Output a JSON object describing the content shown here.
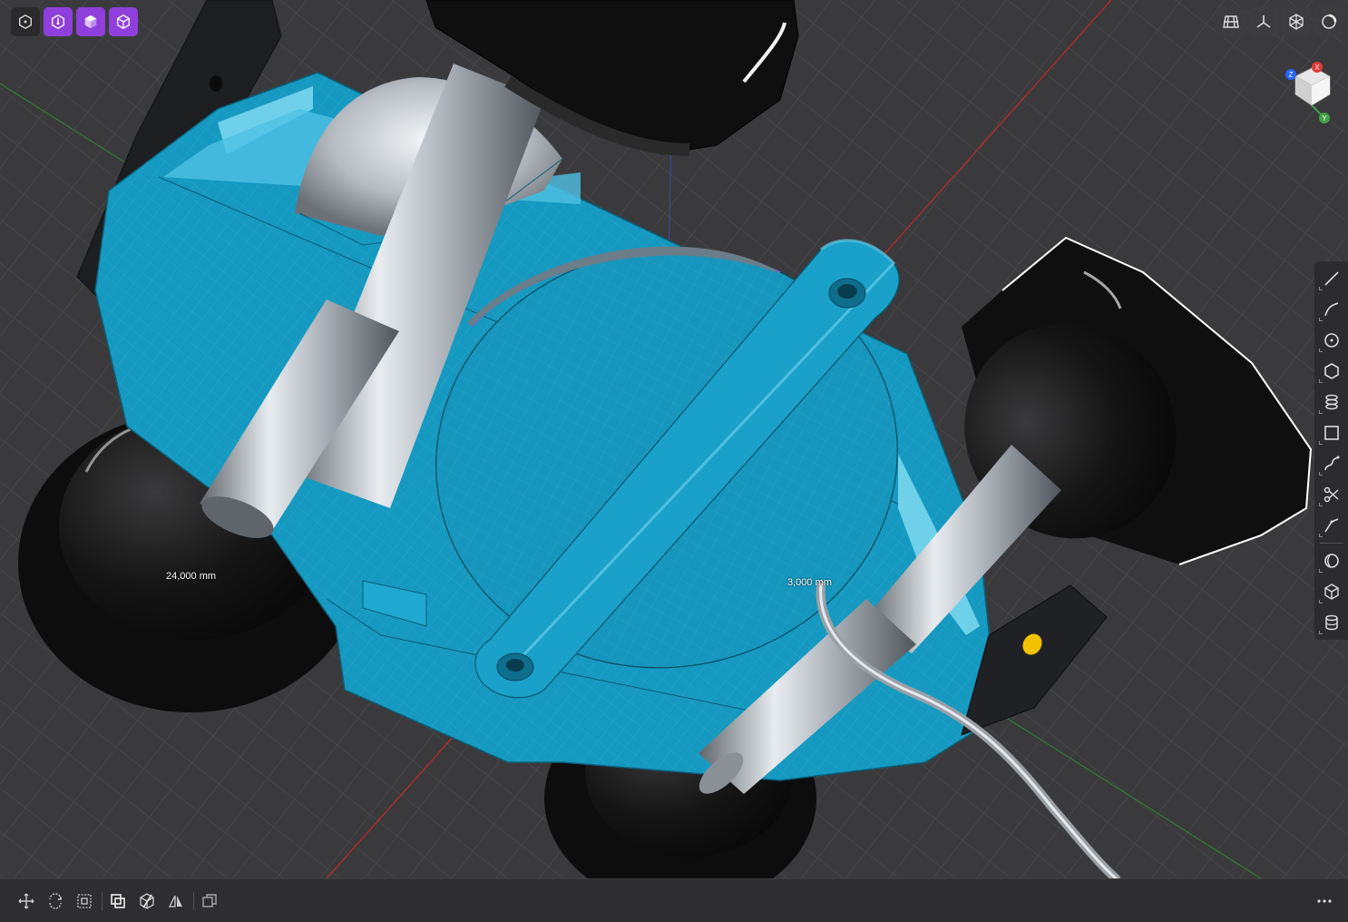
{
  "viewport": {
    "dimensions": [
      {
        "id": "wheel-width",
        "text": "24,000 mm"
      },
      {
        "id": "wire-radius",
        "text": "3,000 mm"
      }
    ],
    "colors": {
      "background": "#3a3a3c",
      "body": "#1aa0c8",
      "body_dark": "#0f86aa",
      "tire": "#121212",
      "axle": "#c7cdd3",
      "axis_x": "#c62828",
      "axis_y": "#2e7d32",
      "axis_z": "#3d5afe"
    }
  },
  "toolbar_top_left": [
    {
      "name": "object-mode-icon",
      "active": false
    },
    {
      "name": "vertex-select-icon",
      "active": true
    },
    {
      "name": "face-select-icon",
      "active": true
    },
    {
      "name": "body-select-icon",
      "active": true
    }
  ],
  "toolbar_top_right": [
    {
      "name": "grid-icon"
    },
    {
      "name": "axes-icon"
    },
    {
      "name": "render-mode-icon"
    },
    {
      "name": "view-settings-icon"
    }
  ],
  "nav_cube": {
    "axis_labels": {
      "z": "Z",
      "x": "X",
      "y": "Y"
    }
  },
  "toolbar_right": [
    "line-tool-icon",
    "arc-tool-icon",
    "circle-tool-icon",
    "polygon-tool-icon",
    "loft-tool-icon",
    "rectangle-tool-icon",
    "spline-tool-icon",
    "trim-tool-icon",
    "extend-tool-icon",
    "sphere-tool-icon",
    "box-tool-icon",
    "cylinder-tool-icon"
  ],
  "toolbar_bottom": [
    "move-icon",
    "rotate-icon",
    "scale-icon",
    "boolean-icon",
    "cut-icon",
    "mirror-icon",
    "duplicate-icon",
    "more-icon"
  ]
}
